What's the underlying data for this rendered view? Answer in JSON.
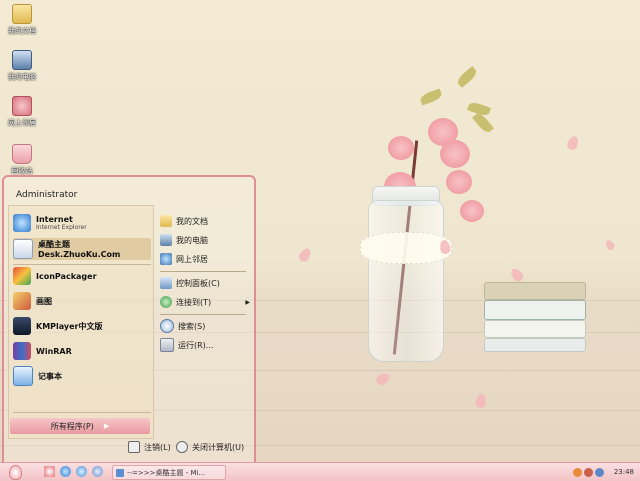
{
  "desktop": {
    "icons": [
      {
        "label": "我的文档",
        "icon": "my-documents-icon"
      },
      {
        "label": "我的电脑",
        "icon": "my-computer-icon"
      },
      {
        "label": "网上邻居",
        "icon": "network-places-icon"
      },
      {
        "label": "回收站",
        "icon": "recycle-bin-icon"
      }
    ]
  },
  "start_menu": {
    "user": "Administrator",
    "left_items": [
      {
        "title": "Internet",
        "subtitle": "Internet Explorer",
        "icon": "internet-explorer-icon"
      },
      {
        "title": "桌酷主题Desk.ZhuoKu.Com",
        "icon": "zhuoku-theme-icon"
      },
      {
        "title": "IconPackager",
        "icon": "iconpackager-icon"
      },
      {
        "title": "画图",
        "icon": "paint-icon"
      },
      {
        "title": "KMPlayer中文版",
        "icon": "kmplayer-icon"
      },
      {
        "title": "WinRAR",
        "icon": "winrar-icon"
      },
      {
        "title": "记事本",
        "icon": "notepad-icon"
      }
    ],
    "all_programs": "所有程序(P)",
    "right_items": [
      {
        "label": "我的文档",
        "icon": "my-documents-icon"
      },
      {
        "label": "我的电脑",
        "icon": "my-computer-icon"
      },
      {
        "label": "网上邻居",
        "icon": "network-places-icon"
      },
      {
        "label": "控制面板(C)",
        "icon": "control-panel-icon"
      },
      {
        "label": "连接到(T)",
        "icon": "connect-to-icon"
      },
      {
        "label": "搜索(S)",
        "icon": "search-icon"
      },
      {
        "label": "运行(R)...",
        "icon": "run-icon"
      }
    ],
    "logoff": "注销(L)",
    "shutdown": "关闭计算机(U)"
  },
  "taskbar": {
    "task_label": "--=>>>桌酷主题 - Mi...",
    "clock": "23:48"
  },
  "colors": {
    "menu_border": "#e08e95",
    "taskbar_top": "#fbe0e2",
    "taskbar_bottom": "#f2c3c6"
  }
}
